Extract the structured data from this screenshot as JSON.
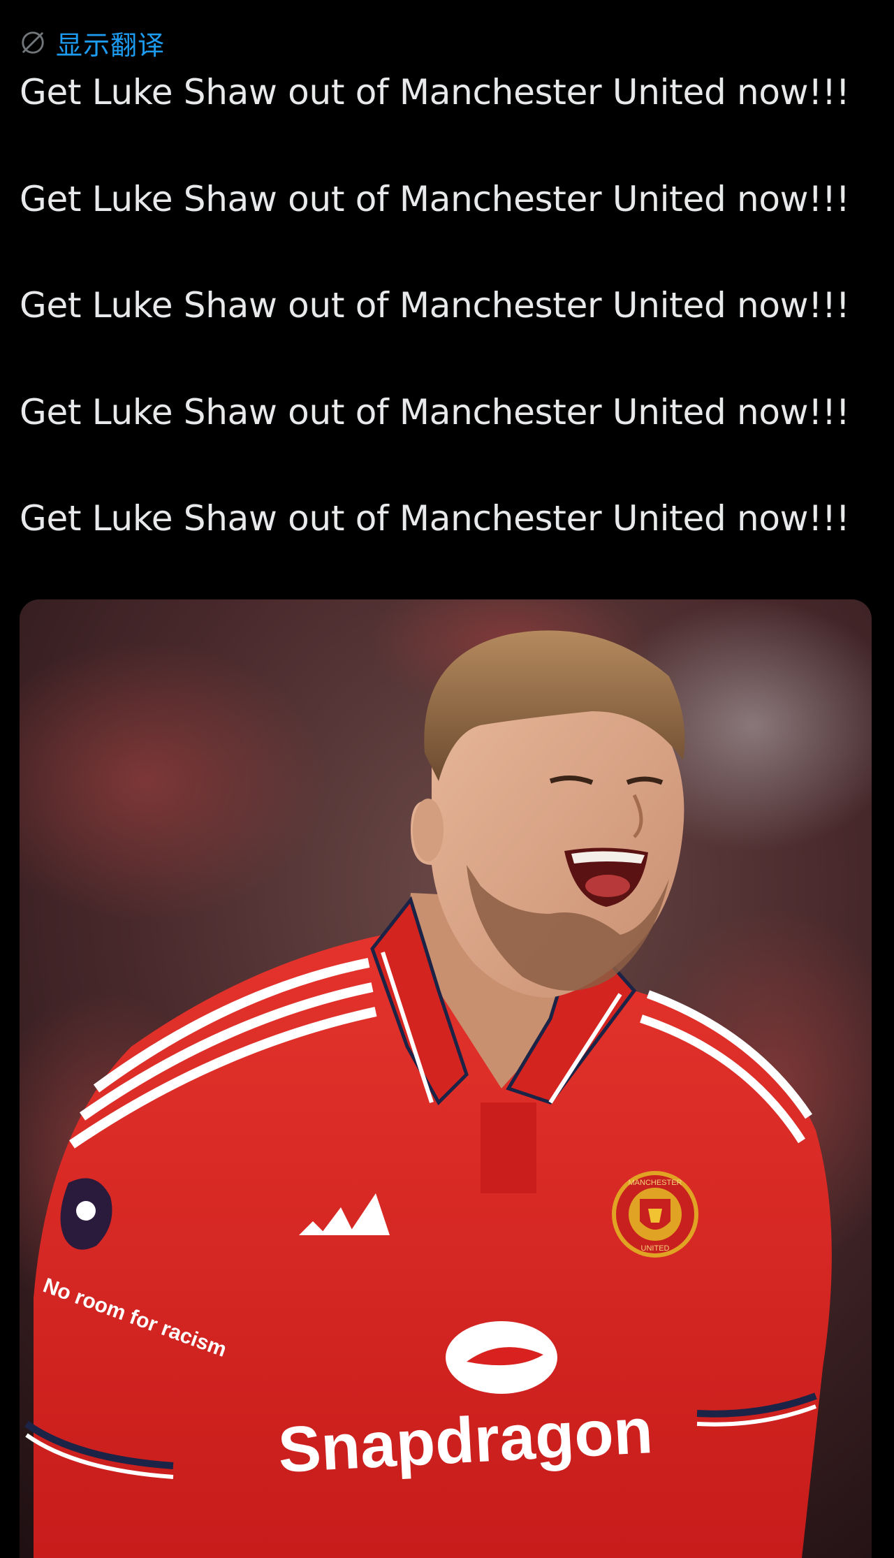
{
  "translate": {
    "label": "显示翻译",
    "icon": "globe-icon",
    "color": "#1d9bf0"
  },
  "tweet": {
    "lines": [
      "Get Luke Shaw out of Manchester United now!!!",
      "Get Luke Shaw out of Manchester United now!!!",
      "Get Luke Shaw out of Manchester United now!!!",
      "Get Luke Shaw out of Manchester United now!!!",
      "Get Luke Shaw out of Manchester United now!!!"
    ]
  },
  "media": {
    "shirt_sponsor": "Snapdragon",
    "badge_top_text": "MANCHESTER",
    "badge_bottom_text": "UNITED",
    "sleeve_text": "No room for racism",
    "shirt_color": "#d9221f",
    "background_color": "#2a1416"
  },
  "colors": {
    "background": "#000000",
    "text": "#e7e9ea",
    "link": "#1d9bf0"
  }
}
